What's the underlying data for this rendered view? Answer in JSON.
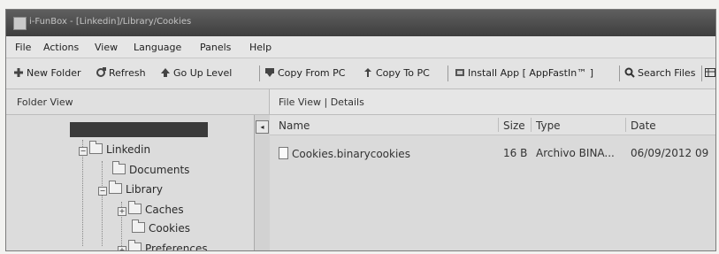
{
  "window": {
    "title": "i-FunBox - [Linkedin]/Library/Cookies"
  },
  "menu": {
    "items": [
      "File",
      "Actions",
      "View",
      "Language",
      "Panels",
      "Help"
    ]
  },
  "toolbar": {
    "new_folder": "New Folder",
    "refresh": "Refresh",
    "go_up": "Go Up Level",
    "copy_from_pc": "Copy From PC",
    "copy_to_pc": "Copy To PC",
    "install_app": "Install App [ AppFastIn™ ]",
    "search_files": "Search Files"
  },
  "panels": {
    "folder_view": "Folder View",
    "file_view": "File View | Details"
  },
  "tree": {
    "nodes": [
      "Linkedin",
      "Documents",
      "Library",
      "Caches",
      "Cookies",
      "Preferences"
    ]
  },
  "list": {
    "columns": [
      "Name",
      "Size",
      "Type",
      "Date"
    ],
    "rows": [
      {
        "name": "Cookies.binarycookies",
        "size": "16 B",
        "type": "Archivo BINA...",
        "date": "06/09/2012 09"
      }
    ]
  },
  "icons": {
    "new_folder": "plus-icon",
    "refresh": "refresh-icon",
    "go_up": "arrow-up-icon",
    "copy_from_pc": "download-icon",
    "copy_to_pc": "upload-icon",
    "install_app": "app-icon",
    "search": "search-icon"
  },
  "colors": {
    "background": "#dcdcdc",
    "titlebar": "#4a4a4a",
    "selection": "#3a3a3a"
  }
}
